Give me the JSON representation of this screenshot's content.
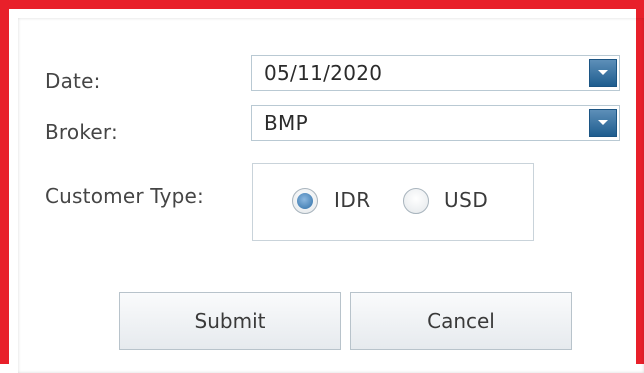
{
  "form": {
    "date_label": "Date:",
    "date_value": "05/11/2020",
    "broker_label": "Broker:",
    "broker_value": "BMP",
    "customer_type_label": "Customer Type:",
    "customer_type_options": [
      {
        "label": "IDR",
        "selected": true
      },
      {
        "label": "USD",
        "selected": false
      }
    ],
    "submit_label": "Submit",
    "cancel_label": "Cancel"
  },
  "colors": {
    "frame_border": "#e8202a",
    "accent": "#2f6fa7"
  },
  "icons": {
    "dropdown": "chevron-down-icon"
  }
}
